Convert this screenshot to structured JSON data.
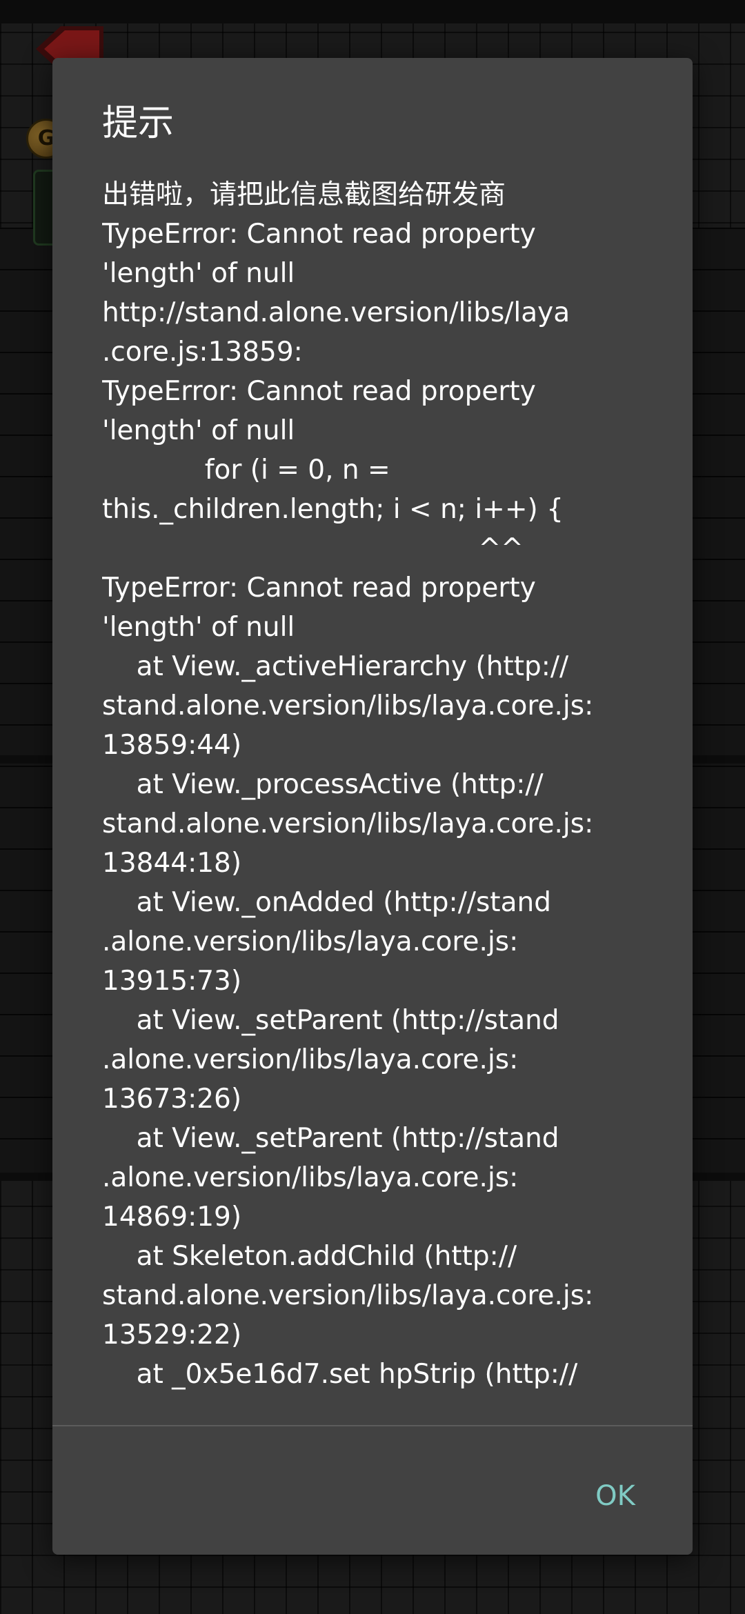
{
  "dialog": {
    "title": "提示",
    "message": "出错啦，请把此信息截图给研发商\nTypeError: Cannot read property\n'length' of null\nhttp://stand.alone.version/libs/laya\n.core.js:13859:\nTypeError: Cannot read property\n'length' of null\n            for (i = 0, n =\nthis._children.length; i < n; i++) {\n                                            ^^\nTypeError: Cannot read property\n'length' of null\n    at View._activeHierarchy (http://\nstand.alone.version/libs/laya.core.js:\n13859:44)\n    at View._processActive (http://\nstand.alone.version/libs/laya.core.js:\n13844:18)\n    at View._onAdded (http://stand\n.alone.version/libs/laya.core.js:\n13915:73)\n    at View._setParent (http://stand\n.alone.version/libs/laya.core.js:\n13673:26)\n    at View._setParent (http://stand\n.alone.version/libs/laya.core.js:\n14869:19)\n    at Skeleton.addChild (http://\nstand.alone.version/libs/laya.core.js:\n13529:22)\n    at _0x5e16d7.set hpStrip (http://",
    "ok_label": "OK"
  },
  "background": {
    "coin_letter": "G"
  },
  "colors": {
    "dialog_bg": "#424242",
    "text": "#ffffff",
    "accent": "#80cbc4",
    "divider": "#5c5c5c"
  },
  "icons": {
    "back": "back-arrow-icon",
    "coin": "coin-icon"
  }
}
